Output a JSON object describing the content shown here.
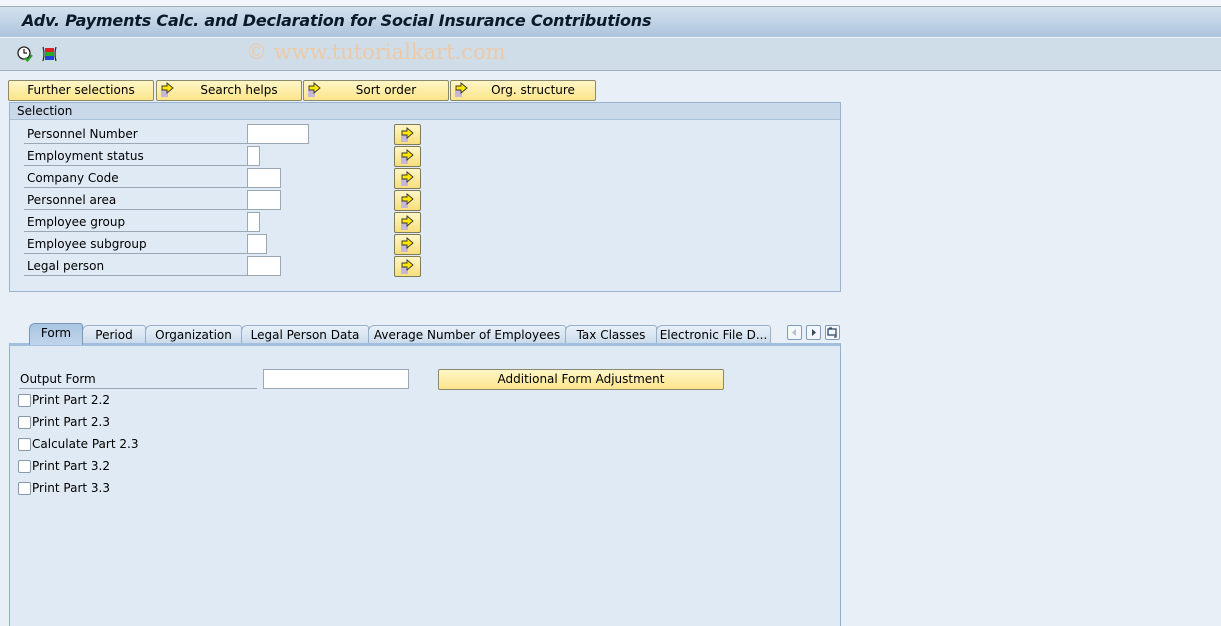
{
  "window": {
    "title": "Adv. Payments Calc. and Declaration for Social Insurance Contributions"
  },
  "toolbar": {
    "watermark": "© www.tutorialkart.com",
    "icons": [
      {
        "name": "execute-icon",
        "glyph": "clock-with-check"
      },
      {
        "name": "selection-options-icon",
        "glyph": "colored-bars"
      }
    ]
  },
  "selection_buttons": [
    {
      "label": "Further selections",
      "icon": null
    },
    {
      "label": "Search helps",
      "icon": "arrow-right-icon"
    },
    {
      "label": "Sort order",
      "icon": "arrow-right-icon"
    },
    {
      "label": "Org. structure",
      "icon": "arrow-right-icon"
    }
  ],
  "selection": {
    "title": "Selection",
    "fields": [
      {
        "label": "Personnel Number",
        "value": ""
      },
      {
        "label": "Employment status",
        "value": ""
      },
      {
        "label": "Company Code",
        "value": ""
      },
      {
        "label": "Personnel area",
        "value": ""
      },
      {
        "label": "Employee group",
        "value": ""
      },
      {
        "label": "Employee subgroup",
        "value": ""
      },
      {
        "label": "Legal person",
        "value": ""
      }
    ]
  },
  "tabs": [
    {
      "label": "Form",
      "active": true
    },
    {
      "label": "Period",
      "active": false
    },
    {
      "label": "Organization",
      "active": false
    },
    {
      "label": "Legal Person Data",
      "active": false
    },
    {
      "label": "Average Number of Employees",
      "active": false
    },
    {
      "label": "Tax Classes",
      "active": false
    },
    {
      "label": "Electronic File D...",
      "active": false
    }
  ],
  "tab_nav": {
    "prev": "scroll-left-icon",
    "next": "scroll-right-icon",
    "list": "tab-list-icon"
  },
  "form_tab": {
    "output_form_label": "Output Form",
    "output_form_value": "",
    "additional_button": "Additional Form Adjustment",
    "checkboxes": [
      {
        "label": "Print Part 2.2",
        "checked": false
      },
      {
        "label": "Print Part 2.3",
        "checked": false
      },
      {
        "label": "Calculate Part 2.3",
        "checked": false
      },
      {
        "label": "Print Part 3.2",
        "checked": false
      },
      {
        "label": "Print Part 3.3",
        "checked": false
      }
    ]
  },
  "colors": {
    "button_yellow": "#fbe58a",
    "background": "#e8eff7",
    "panel": "#dfeaf4"
  }
}
